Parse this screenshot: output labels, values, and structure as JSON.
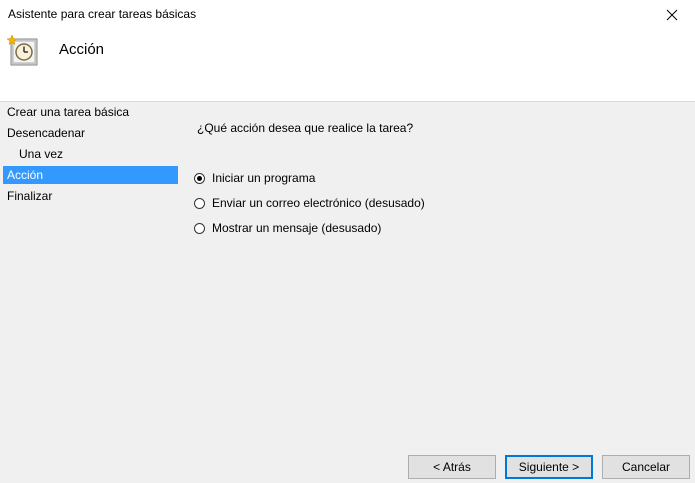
{
  "window": {
    "title": "Asistente para crear tareas básicas"
  },
  "header": {
    "title": "Acción",
    "icon": "task-scheduler-icon"
  },
  "sidebar": {
    "items": [
      {
        "label": "Crear una tarea básica",
        "active": false
      },
      {
        "label": "Desencadenar",
        "active": false
      },
      {
        "label": "Una vez",
        "active": false
      },
      {
        "label": "Acción",
        "active": true
      },
      {
        "label": "Finalizar",
        "active": false
      }
    ]
  },
  "main": {
    "question": "¿Qué acción desea que realice la tarea?",
    "options": [
      {
        "label": "Iniciar un programa",
        "checked": true
      },
      {
        "label": "Enviar un correo electrónico (desusado)",
        "checked": false
      },
      {
        "label": "Mostrar un mensaje (desusado)",
        "checked": false
      }
    ]
  },
  "buttons": {
    "back": "< Atrás",
    "next": "Siguiente >",
    "cancel": "Cancelar"
  },
  "colors": {
    "selection": "#3399ff",
    "default_button_border": "#0078d7"
  }
}
